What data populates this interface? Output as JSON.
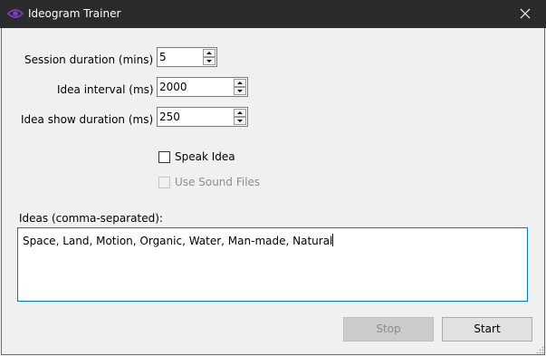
{
  "window": {
    "title": "Ideogram Trainer"
  },
  "icons": {
    "app": "eye-icon",
    "close": "close-icon"
  },
  "fields": {
    "session_duration": {
      "label": "Session duration (mins)",
      "value": "5"
    },
    "idea_interval": {
      "label": "Idea interval (ms)",
      "value": "2000"
    },
    "idea_show_duration": {
      "label": "Idea show duration (ms)",
      "value": "250"
    }
  },
  "checkboxes": {
    "speak_idea": {
      "label": "Speak Idea",
      "checked": false,
      "enabled": true
    },
    "use_sound_files": {
      "label": "Use Sound Files",
      "checked": false,
      "enabled": false
    }
  },
  "ideas": {
    "label": "Ideas (comma-separated):",
    "value": "Space, Land, Motion, Organic, Water, Man-made, Natural"
  },
  "buttons": {
    "stop": "Stop",
    "start": "Start"
  },
  "colors": {
    "titlebar": "#2b2b2b",
    "focus_border": "#0078d7",
    "app_icon": "#7b3fc4"
  }
}
